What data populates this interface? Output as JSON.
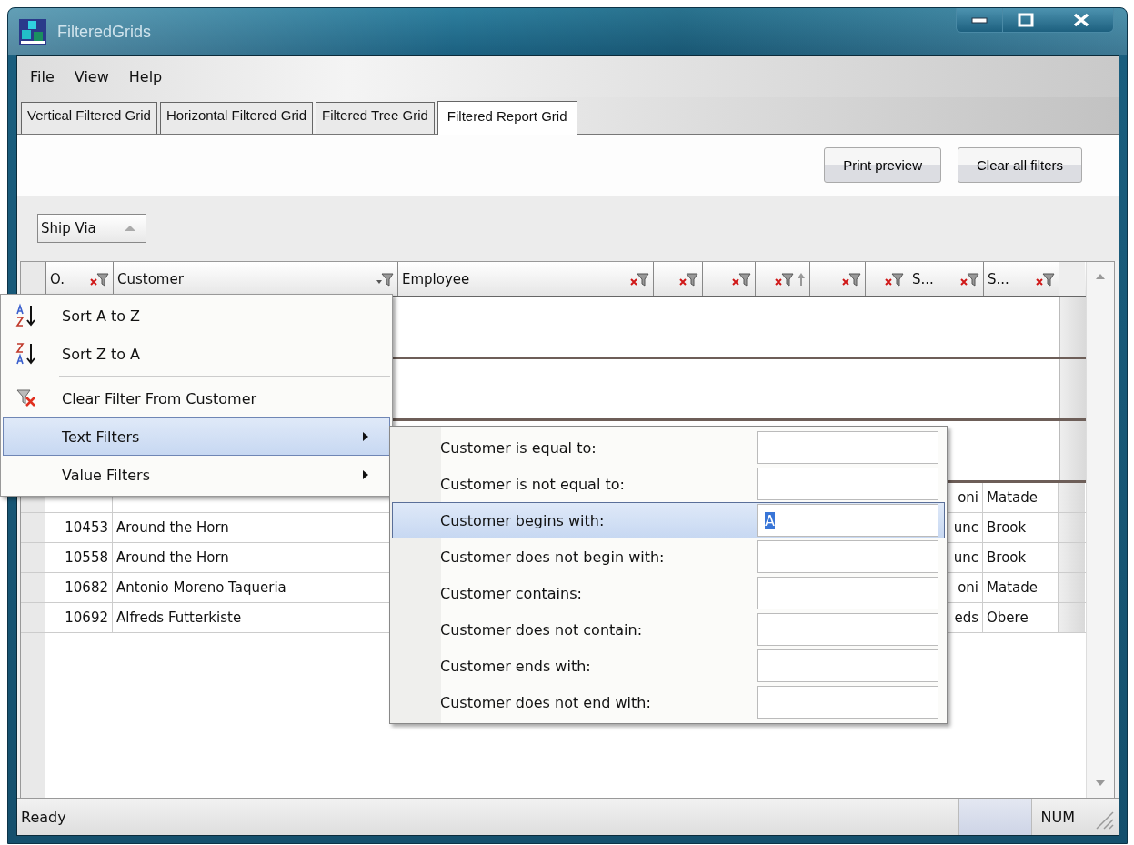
{
  "window": {
    "title": "FilteredGrids"
  },
  "menu_bar": [
    "File",
    "View",
    "Help"
  ],
  "tabs": [
    {
      "label": "Vertical Filtered Grid",
      "selected": false
    },
    {
      "label": "Horizontal Filtered Grid",
      "selected": false
    },
    {
      "label": "Filtered Tree Grid",
      "selected": false
    },
    {
      "label": "Filtered Report Grid",
      "selected": true
    }
  ],
  "toolbar_buttons": [
    "Print preview",
    "Clear all filters"
  ],
  "group_by": [
    {
      "label": "Ship Via"
    }
  ],
  "grid": {
    "columns": [
      {
        "label": "O.",
        "filter_active": true,
        "sorted": false
      },
      {
        "label": "Customer",
        "filter_active": false,
        "sorted": false
      },
      {
        "label": "Employee",
        "filter_active": true,
        "sorted": false
      },
      {
        "filter_active": true,
        "sorted": false
      },
      {
        "filter_active": true,
        "sorted": false
      },
      {
        "filter_active": true,
        "sorted": true
      },
      {
        "filter_active": true,
        "sorted": false
      },
      {
        "filter_active": true,
        "sorted": false
      },
      {
        "label": "S...",
        "filter_active": true,
        "sorted": false
      },
      {
        "label": "S...",
        "filter_active": true,
        "sorted": false
      }
    ],
    "rows": [
      {
        "cells": [
          "",
          "",
          "",
          "",
          "",
          "",
          "",
          "",
          "oni",
          "Matade"
        ]
      },
      {
        "cells": [
          "10453",
          "Around the Horn",
          "",
          "",
          "",
          "",
          "",
          "",
          "unc",
          "Brook"
        ]
      },
      {
        "cells": [
          "10558",
          "Around the Horn",
          "",
          "",
          "",
          "",
          "",
          "",
          "unc",
          "Brook"
        ]
      },
      {
        "cells": [
          "10682",
          "Antonio Moreno Taqueria",
          "",
          "",
          "",
          "",
          "",
          "",
          "oni",
          "Matade"
        ]
      },
      {
        "cells": [
          "10692",
          "Alfreds Futterkiste",
          "",
          "",
          "",
          "",
          "",
          "",
          "eds",
          "Obere"
        ]
      }
    ]
  },
  "context_menu": [
    {
      "kind": "sort_asc",
      "label": "Sort A to Z",
      "selected": false
    },
    {
      "kind": "sort_desc",
      "label": "Sort Z to A",
      "selected": false
    },
    {
      "kind": "separator"
    },
    {
      "kind": "clear_filter",
      "label": "Clear Filter From Customer",
      "selected": false
    },
    {
      "kind": "submenu",
      "label": "Text Filters",
      "selected": true
    },
    {
      "kind": "submenu",
      "label": "Value Filters",
      "selected": false
    }
  ],
  "text_filters": [
    {
      "label": "Customer is equal to:",
      "selected": false
    },
    {
      "label": "Customer is not equal to:",
      "selected": false
    },
    {
      "label": "Customer begins with:",
      "selected": true,
      "value": "A"
    },
    {
      "label": "Customer does not begin with:",
      "selected": false
    },
    {
      "label": "Customer contains:",
      "selected": false
    },
    {
      "label": "Customer does not contain:",
      "selected": false
    },
    {
      "label": "Customer ends with:",
      "selected": false
    },
    {
      "label": "Customer does not end with:",
      "selected": false
    }
  ],
  "status_bar": {
    "message": "Ready",
    "indicators": [
      "NUM"
    ]
  }
}
